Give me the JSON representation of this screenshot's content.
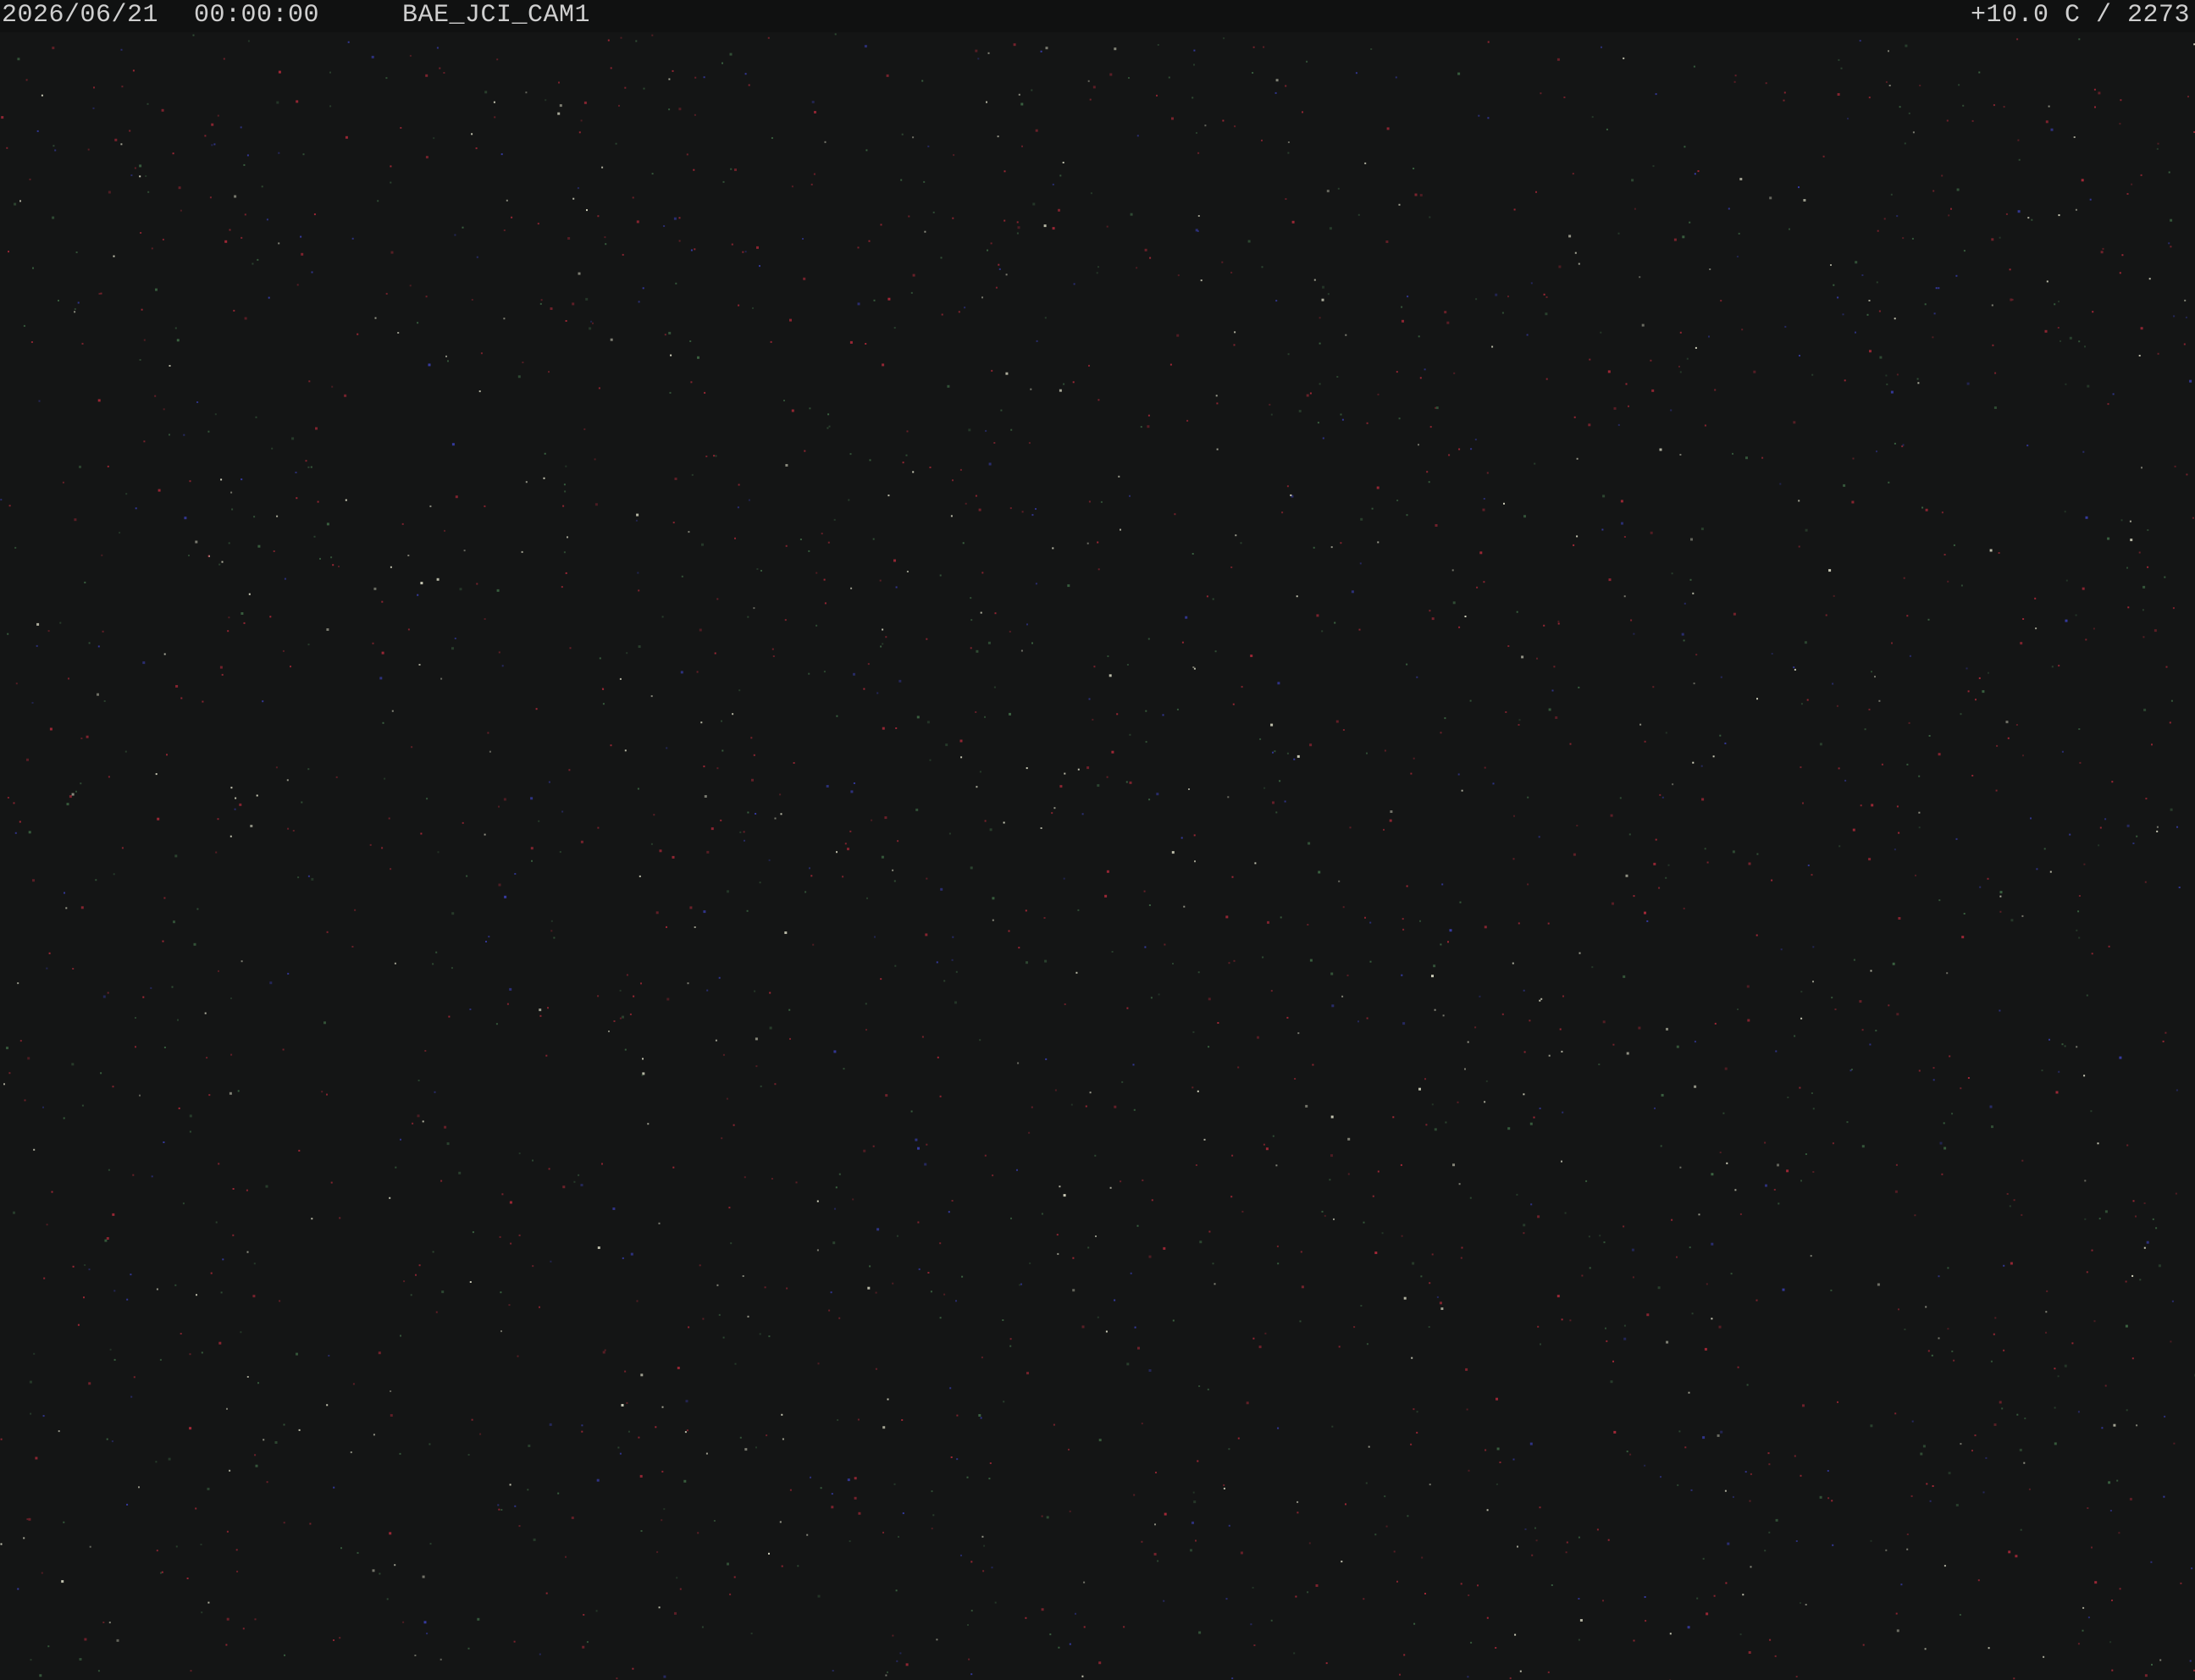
{
  "overlay": {
    "date": "2026/06/21",
    "time": "00:00:00",
    "camera_name": "BAE_JCI_CAM1",
    "temperature_readout": "+10.0 C / 2273"
  },
  "colors": {
    "background": "#141515",
    "overlay_bar": "#101111",
    "overlay_text": "#cfcfcf",
    "noise_red": "#b02a3a",
    "noise_green": "#3f6a45",
    "noise_blue": "#3a3fb0",
    "noise_white": "#e8e8d0"
  }
}
